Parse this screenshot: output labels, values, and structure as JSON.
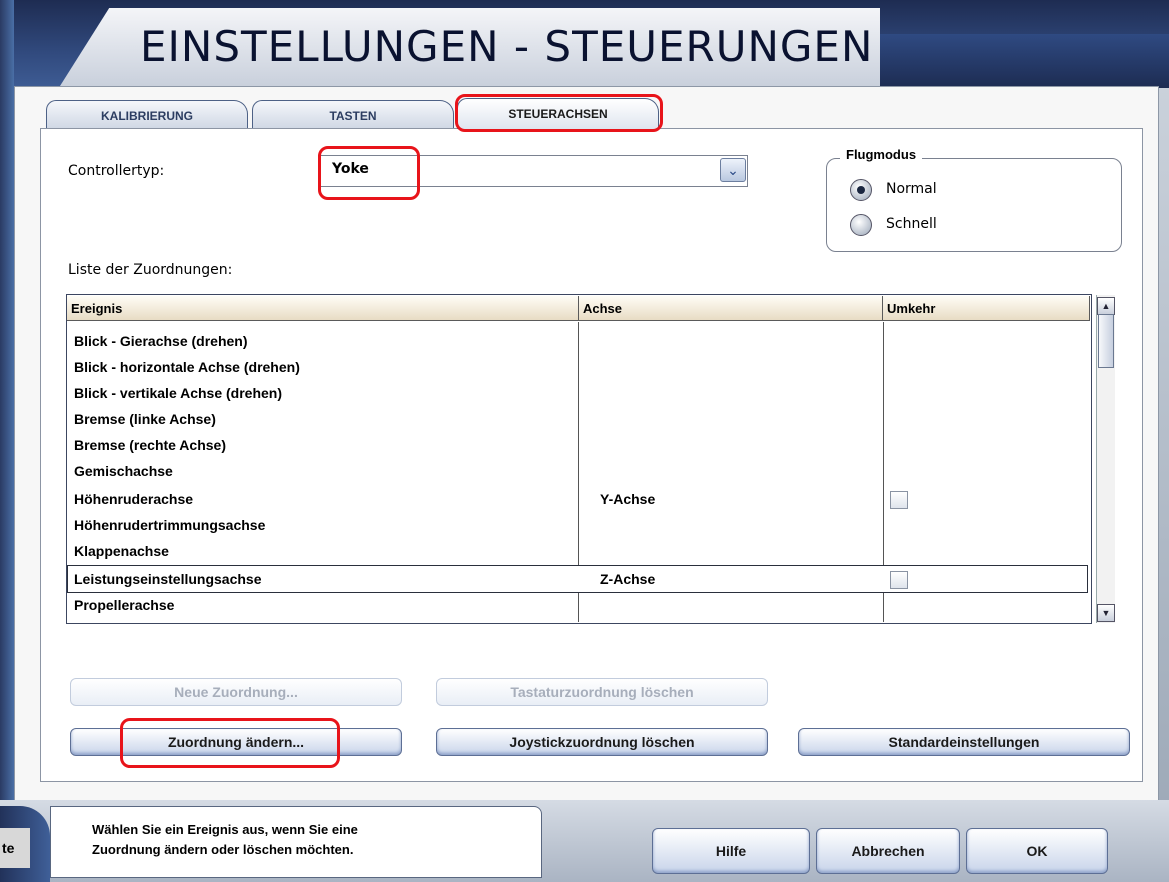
{
  "window": {
    "title": "EINSTELLUNGEN - STEUERUNGEN"
  },
  "tabs": [
    {
      "label": "KALIBRIERUNG",
      "active": false
    },
    {
      "label": "TASTEN",
      "active": false
    },
    {
      "label": "STEUERACHSEN",
      "active": true
    }
  ],
  "controller": {
    "label": "Controllertyp:",
    "value": "Yoke",
    "dropdown_icon": "chevron-down-icon"
  },
  "flugmodus": {
    "title": "Flugmodus",
    "options": [
      {
        "label": "Normal",
        "selected": true
      },
      {
        "label": "Schnell",
        "selected": false
      }
    ]
  },
  "list": {
    "label": "Liste der Zuordnungen:",
    "columns": [
      "Ereignis",
      "Achse",
      "Umkehr"
    ],
    "rows": [
      {
        "event": "Blick - Gierachse (drehen)",
        "axis": "",
        "reverse": null
      },
      {
        "event": "Blick - horizontale Achse (drehen)",
        "axis": "",
        "reverse": null
      },
      {
        "event": "Blick - vertikale Achse (drehen)",
        "axis": "",
        "reverse": null
      },
      {
        "event": "Bremse (linke Achse)",
        "axis": "",
        "reverse": null
      },
      {
        "event": "Bremse (rechte Achse)",
        "axis": "",
        "reverse": null
      },
      {
        "event": "Gemischachse",
        "axis": "",
        "reverse": null
      },
      {
        "event": "Höhenruderachse",
        "axis": "Y-Achse",
        "reverse": false
      },
      {
        "event": "Höhenrudertrimmungsachse",
        "axis": "",
        "reverse": null
      },
      {
        "event": "Klappenachse",
        "axis": "",
        "reverse": null
      },
      {
        "event": "Leistungseinstellungsachse",
        "axis": "Z-Achse",
        "reverse": false,
        "selected": true
      },
      {
        "event": "Propellerachse",
        "axis": "",
        "reverse": null
      }
    ]
  },
  "buttons": {
    "new_mapping": "Neue Zuordnung...",
    "delete_keyboard": "Tastaturzuordnung löschen",
    "change_mapping": "Zuordnung ändern...",
    "delete_joystick": "Joystickzuordnung löschen",
    "defaults": "Standardeinstellungen",
    "help": "Hilfe",
    "cancel": "Abbrechen",
    "ok": "OK"
  },
  "hint": "Wählen Sie ein Ereignis aus, wenn Sie eine\nZuordnung ändern oder löschen möchten.",
  "background_fragment": "te",
  "colors": {
    "highlight": "#e8141a",
    "frame_dark": "#1e2c52",
    "header_bg": "#e8dcc4"
  }
}
